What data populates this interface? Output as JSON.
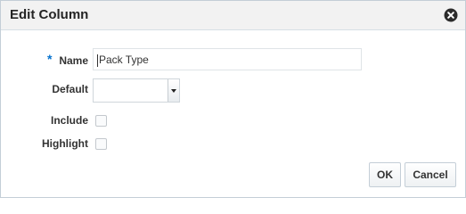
{
  "dialog": {
    "title": "Edit Column",
    "close_icon": "close-circle-icon"
  },
  "form": {
    "name": {
      "required_marker": "*",
      "label": "Name",
      "value": "Pack Type"
    },
    "default": {
      "label": "Default",
      "selected": ""
    },
    "include": {
      "label": "Include",
      "checked": false
    },
    "highlight": {
      "label": "Highlight",
      "checked": false
    }
  },
  "buttons": {
    "ok": "OK",
    "cancel": "Cancel"
  }
}
